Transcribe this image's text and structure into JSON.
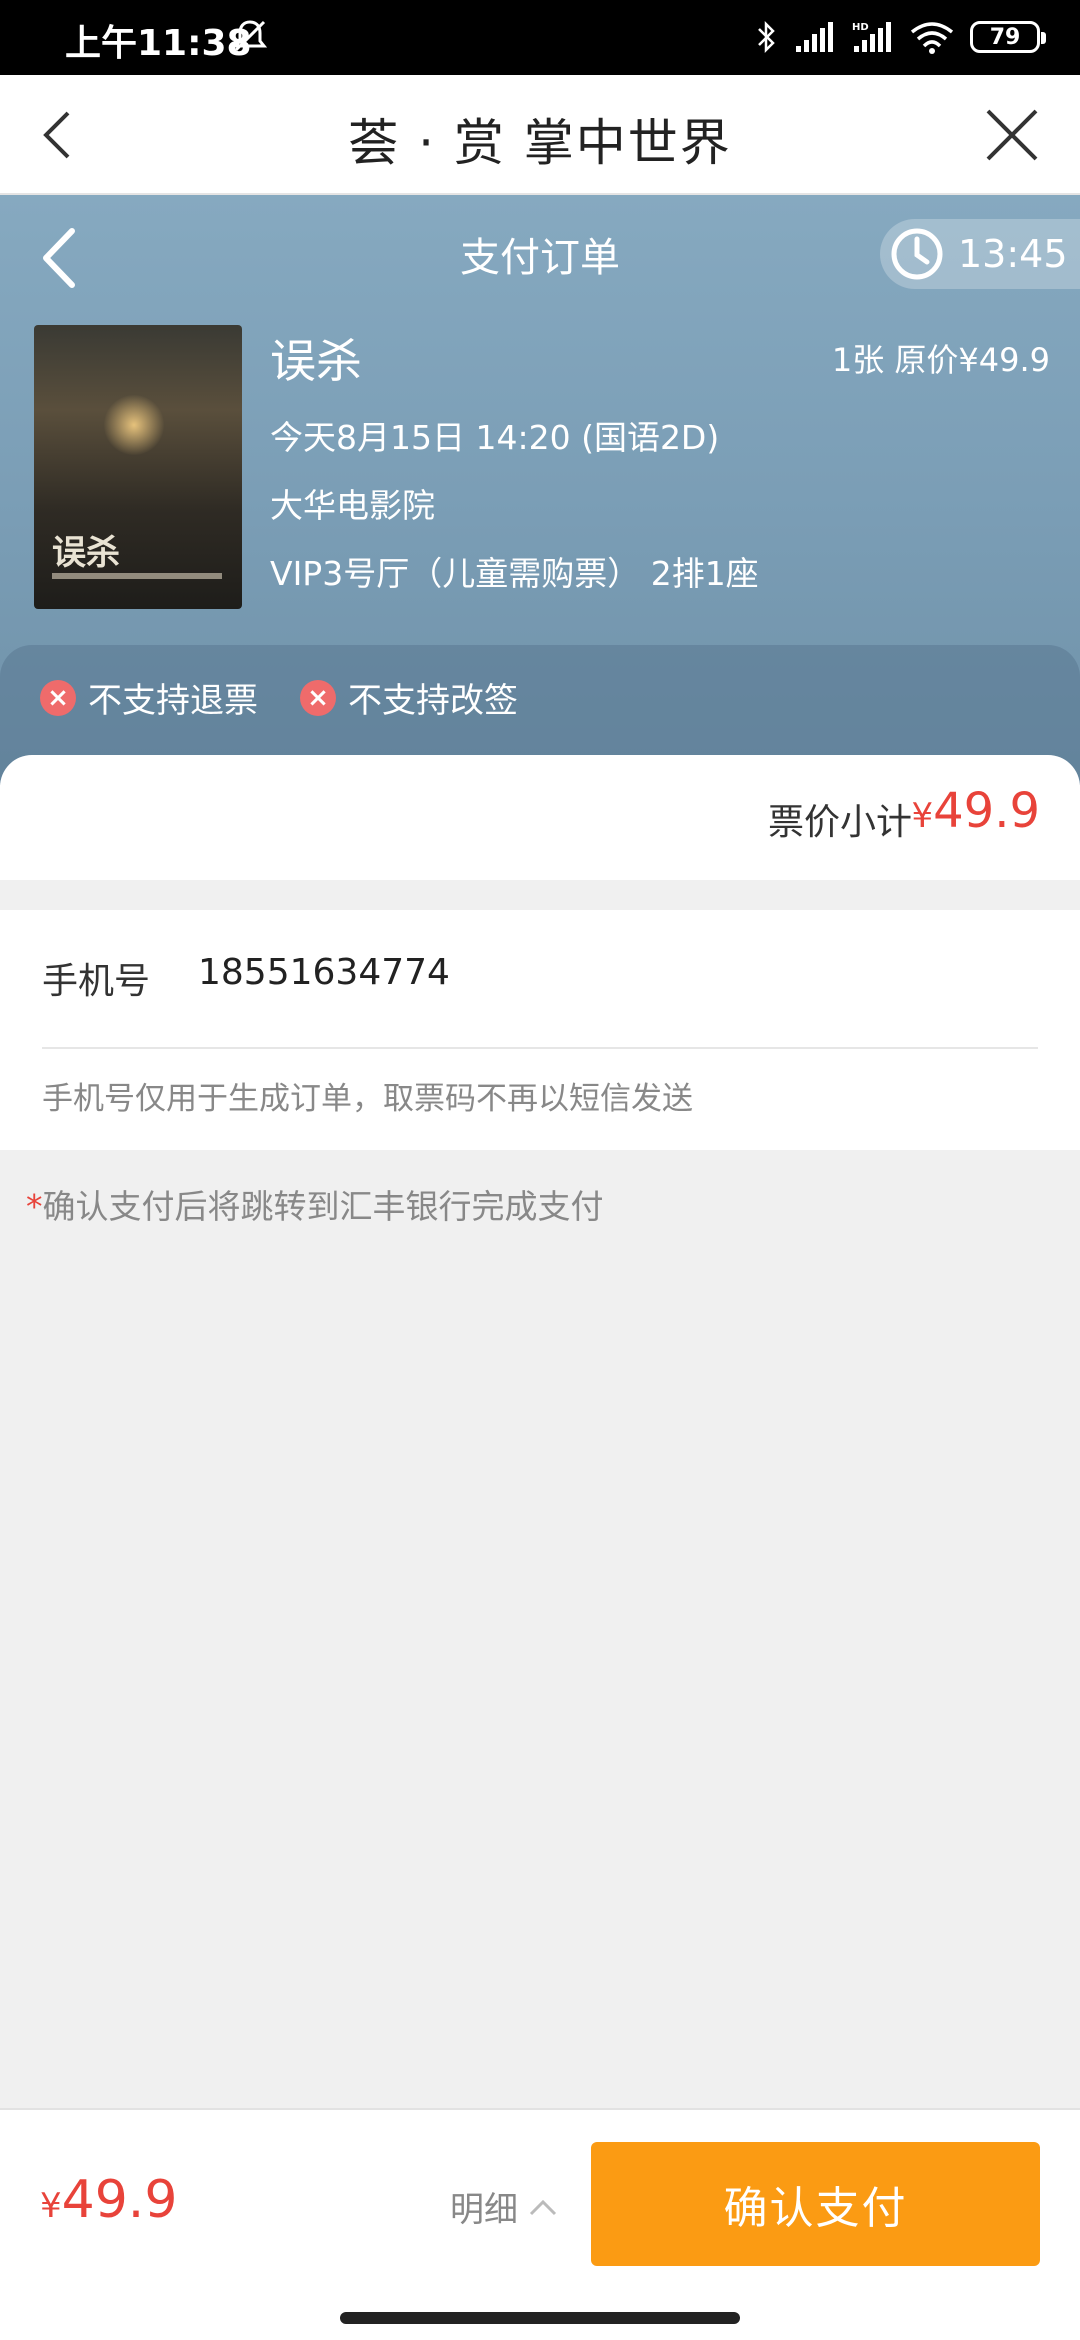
{
  "status_bar": {
    "time": "上午11:38",
    "battery": "79",
    "icons": [
      "mute-icon",
      "bluetooth-icon",
      "signal-icon",
      "hd-signal-icon",
      "wifi-icon",
      "battery-icon"
    ]
  },
  "app_header": {
    "title": "荟 · 赏 掌中世界",
    "back_icon": "chevron-left-icon",
    "close_icon": "close-icon"
  },
  "order": {
    "page_title": "支付订单",
    "timer": "13:45",
    "movie": {
      "poster_title": "误杀",
      "name": "误杀",
      "qty_price": "1张  原价¥49.9",
      "showtime": "今天8月15日 14:20 (国语2D)",
      "cinema": "大华电影院",
      "hall_seat": "VIP3号厅（儿童需购票） 2排1座"
    },
    "policies": [
      "不支持退票",
      "不支持改签"
    ],
    "subtotal_label": "票价小计",
    "subtotal_currency": "¥",
    "subtotal_amount": "49.9"
  },
  "phone": {
    "label": "手机号",
    "value": "18551634774",
    "note": "手机号仅用于生成订单，取票码不再以短信发送"
  },
  "pay_note": {
    "star": "*",
    "text": "确认支付后将跳转到汇丰银行完成支付"
  },
  "bottom_bar": {
    "currency": "¥",
    "total": "49.9",
    "detail_label": "明细",
    "pay_button": "确认支付"
  },
  "colors": {
    "accent_red": "#e8433a",
    "pay_orange": "#fb9b13",
    "header_blue": "#7a9db5"
  }
}
